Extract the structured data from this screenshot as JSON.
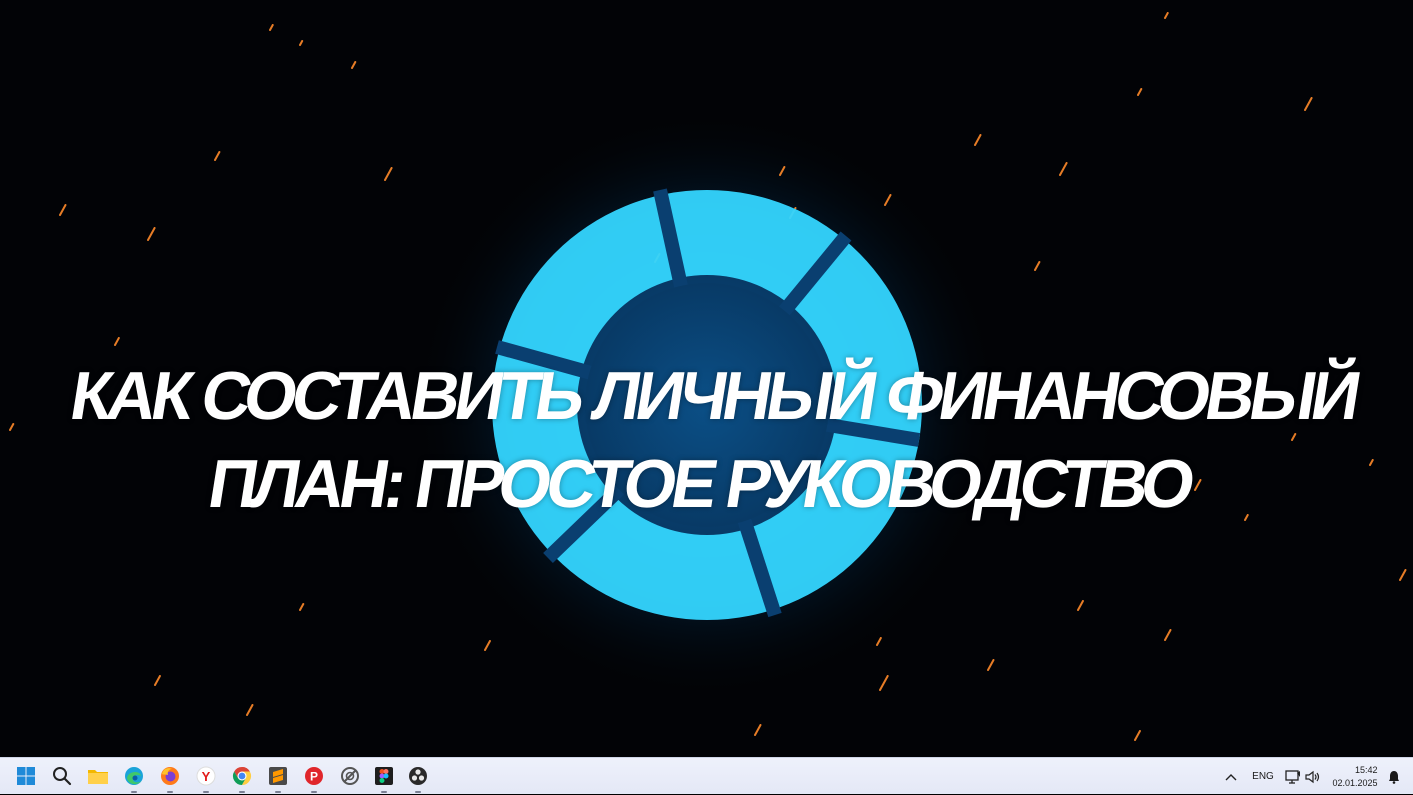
{
  "wallpaper": {
    "headline_line1": "КАК СОСТАВИТЬ ЛИЧНЫЙ ФИНАНСОВЫЙ",
    "headline_line2": "ПЛАН: ПРОСТОЕ РУКОВОДСТВО",
    "logo_color": "#3fe0ff",
    "spark_color": "#ff8a2a"
  },
  "taskbar": {
    "apps": [
      {
        "name": "start-button",
        "icon": "windows-start-icon",
        "pinned": true
      },
      {
        "name": "search-button",
        "icon": "search-icon"
      },
      {
        "name": "file-explorer-button",
        "icon": "folder-icon"
      },
      {
        "name": "edge-button",
        "icon": "edge-icon"
      },
      {
        "name": "firefox-button",
        "icon": "firefox-icon"
      },
      {
        "name": "yandex-browser-button",
        "icon": "yandex-icon"
      },
      {
        "name": "chrome-button",
        "icon": "chrome-icon"
      },
      {
        "name": "sublime-button",
        "icon": "sublime-icon"
      },
      {
        "name": "pushbullet-button",
        "icon": "p-app-icon"
      },
      {
        "name": "vpn-button",
        "icon": "slash-circle-icon"
      },
      {
        "name": "figma-button",
        "icon": "figma-icon"
      },
      {
        "name": "obs-button",
        "icon": "obs-icon"
      }
    ],
    "tray": {
      "overflow_icon": "chevron-up-icon",
      "language": "ENG",
      "network_icon": "monitor-network-icon",
      "volume_icon": "speaker-icon",
      "time": "15:42",
      "date": "02.01.2025",
      "notification_icon": "bell-icon"
    }
  }
}
